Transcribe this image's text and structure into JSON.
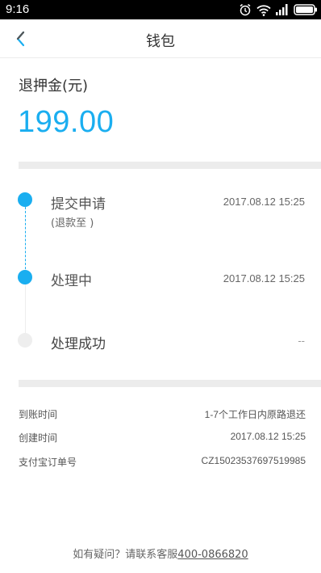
{
  "status_bar": {
    "time": "9:16",
    "icons": [
      "alarm-icon",
      "wifi-icon",
      "signal-icon",
      "battery-icon"
    ]
  },
  "nav": {
    "title": "钱包",
    "back_icon": "chevron-left-icon"
  },
  "refund": {
    "label": "退押金(元)",
    "amount": "199.00",
    "accent_color": "#1aaef0"
  },
  "timeline": [
    {
      "step": "提交申请",
      "time": "2017.08.12 15:25",
      "sub": "(退款至 )",
      "state": "done"
    },
    {
      "step": "处理中",
      "time": "2017.08.12 15:25",
      "sub": "",
      "state": "done"
    },
    {
      "step": "处理成功",
      "time": "--",
      "sub": "",
      "state": "pending"
    }
  ],
  "details": [
    {
      "label": "到账时间",
      "value": "1-7个工作日内原路退还"
    },
    {
      "label": "创建时间",
      "value": "2017.08.12 15:25"
    },
    {
      "label": "支付宝订单号",
      "value": "CZ150235376975​19985"
    }
  ],
  "footer": {
    "prefix": "如有疑问？请联系客服",
    "phone": "400-0866820"
  }
}
